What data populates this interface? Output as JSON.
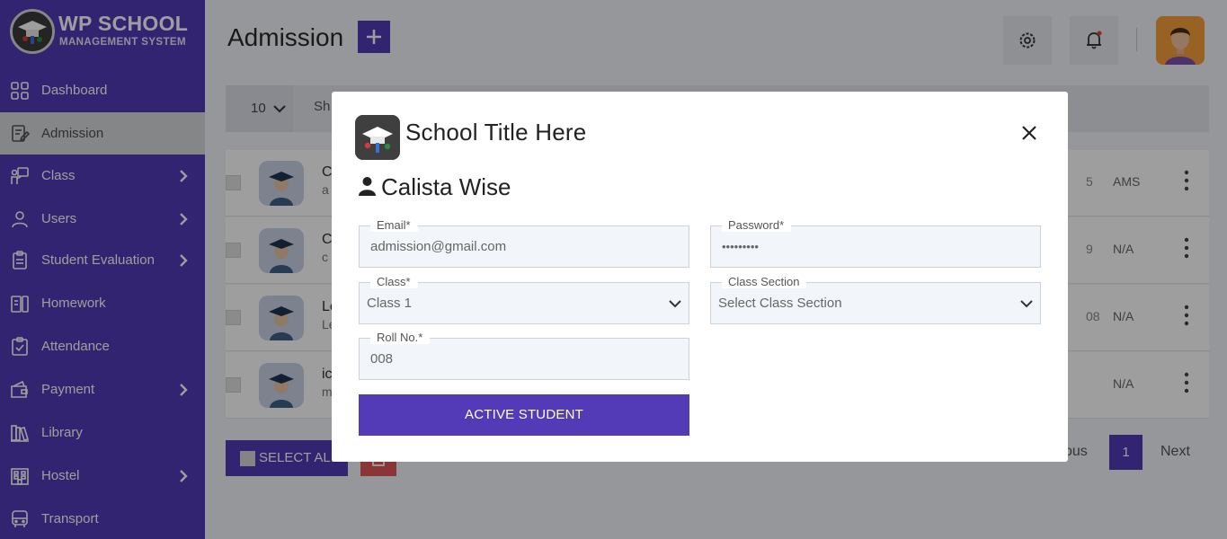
{
  "brand": {
    "title": "WP SCHOOL",
    "subtitle": "MANAGEMENT SYSTEM"
  },
  "sidebar": {
    "items": [
      {
        "label": "Dashboard",
        "icon": "dashboard-icon",
        "chevron": false,
        "active": false
      },
      {
        "label": "Admission",
        "icon": "admission-icon",
        "chevron": false,
        "active": true
      },
      {
        "label": "Class",
        "icon": "class-icon",
        "chevron": true,
        "active": false
      },
      {
        "label": "Users",
        "icon": "users-icon",
        "chevron": true,
        "active": false
      },
      {
        "label": "Student Evaluation",
        "icon": "evaluation-icon",
        "chevron": true,
        "active": false
      },
      {
        "label": "Homework",
        "icon": "homework-icon",
        "chevron": false,
        "active": false
      },
      {
        "label": "Attendance",
        "icon": "attendance-icon",
        "chevron": false,
        "active": false
      },
      {
        "label": "Payment",
        "icon": "payment-icon",
        "chevron": true,
        "active": false
      },
      {
        "label": "Library",
        "icon": "library-icon",
        "chevron": false,
        "active": false
      },
      {
        "label": "Hostel",
        "icon": "hostel-icon",
        "chevron": true,
        "active": false
      },
      {
        "label": "Transport",
        "icon": "transport-icon",
        "chevron": false,
        "active": false
      }
    ]
  },
  "header": {
    "title": "Admission",
    "add_icon": "plus-icon",
    "settings_icon": "gear-icon",
    "notification_icon": "bell-icon"
  },
  "toolbar": {
    "per_page": "10",
    "show_text": "Sh"
  },
  "rows": [
    {
      "name": "C",
      "sub": "a",
      "col1": "5",
      "col2": "AMS"
    },
    {
      "name": "C",
      "sub": "c",
      "col1": "9",
      "col2": "N/A"
    },
    {
      "name": "Le",
      "sub": "Le",
      "col1": "08",
      "col2": "N/A"
    },
    {
      "name": "ic",
      "sub": "m",
      "col1": "",
      "col2": "N/A"
    }
  ],
  "footer": {
    "select_all": "SELECT ALL",
    "prev": "ous",
    "page": "1",
    "next": "Next"
  },
  "modal": {
    "title": "School Title Here",
    "student_name": "Calista Wise",
    "fields": {
      "email": {
        "label": "Email*",
        "value": "admission@gmail.com"
      },
      "password": {
        "label": "Password*",
        "value": "•••••••••"
      },
      "class": {
        "label": "Class*",
        "value": "Class 1"
      },
      "class_section": {
        "label": "Class Section",
        "value": "Select Class Section"
      },
      "roll_no": {
        "label": "Roll No.*",
        "value": "008"
      }
    },
    "submit_label": "ACTIVE STUDENT"
  },
  "colors": {
    "primary": "#533bb7",
    "danger": "#e05757",
    "avatar_bg": "#f59e3b"
  }
}
